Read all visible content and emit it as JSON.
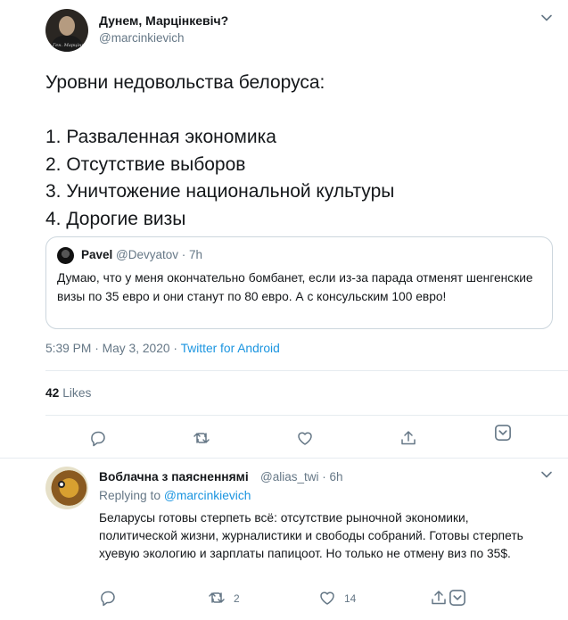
{
  "tweet": {
    "display_name": "Дунем, Марцінкевіч?",
    "handle": "@marcinkievich",
    "avatar_caption": "Ген. Марцінк",
    "text": "Уровни недовольства белоруса:\n\n1. Разваленная экономика\n2. Отсутствие выборов\n3. Уничтожение национальной культуры\n4. Дорогие визы",
    "quote": {
      "name": "Pavel",
      "handle_time": "@Devyatov · 7h",
      "text": "Думаю, что у меня окончательно бомбанет, если из-за парада отменят шенгенские визы по 35 евро и они станут по 80 евро. А с консульским 100 евро!"
    },
    "timestamp": "5:39 PM · May 3, 2020 · ",
    "source": "Twitter for Android",
    "likes_count": "42",
    "likes_label": " Likes"
  },
  "reply": {
    "display_name": "Воблачна з паясненнямі",
    "handle_time": "@alias_twi · 6h",
    "replying_prefix": "Replying to ",
    "replying_to": "@marcinkievich",
    "text": "Беларусы готовы стерпеть всё: отсутствие рыночной экономики, политической жизни, журналистики и свободы собраний. Готовы стерпеть хуевую экологию и зарплаты папицоот. Но   только не отмену виз по 35$.",
    "retweet_count": "2",
    "like_count": "14"
  },
  "icons": {
    "reply": "reply-icon",
    "retweet": "retweet-icon",
    "like": "heart-icon",
    "share": "share-icon",
    "more": "chevron-down-icon"
  },
  "colors": {
    "link": "#1b95e0",
    "muted": "#657786",
    "border": "#e6ecf0"
  }
}
